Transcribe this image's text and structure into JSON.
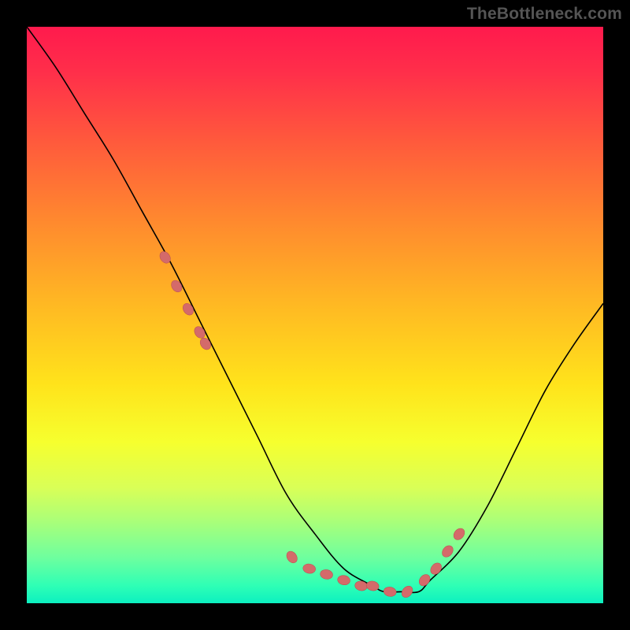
{
  "watermark": "TheBottleneck.com",
  "colors": {
    "background": "#000000",
    "gradient_top": "#ff1a4d",
    "gradient_bottom": "#0cf0c0",
    "curve": "#000000",
    "marker": "#d46a6a"
  },
  "chart_data": {
    "type": "line",
    "title": "",
    "xlabel": "",
    "ylabel": "",
    "xlim": [
      0,
      100
    ],
    "ylim": [
      0,
      100
    ],
    "series": [
      {
        "name": "bottleneck-curve",
        "x": [
          0,
          5,
          10,
          15,
          20,
          25,
          30,
          35,
          40,
          45,
          50,
          55,
          60,
          62,
          65,
          68,
          70,
          75,
          80,
          85,
          90,
          95,
          100
        ],
        "values": [
          100,
          93,
          85,
          77,
          68,
          59,
          49,
          39,
          29,
          19,
          12,
          6,
          3,
          2,
          2,
          2,
          4,
          9,
          17,
          27,
          37,
          45,
          52
        ]
      }
    ],
    "markers": {
      "name": "highlighted-points",
      "x": [
        24,
        26,
        28,
        30,
        31,
        46,
        49,
        52,
        55,
        58,
        60,
        63,
        66,
        69,
        71,
        73,
        75
      ],
      "values": [
        60,
        55,
        51,
        47,
        45,
        8,
        6,
        5,
        4,
        3,
        3,
        2,
        2,
        4,
        6,
        9,
        12
      ]
    }
  }
}
